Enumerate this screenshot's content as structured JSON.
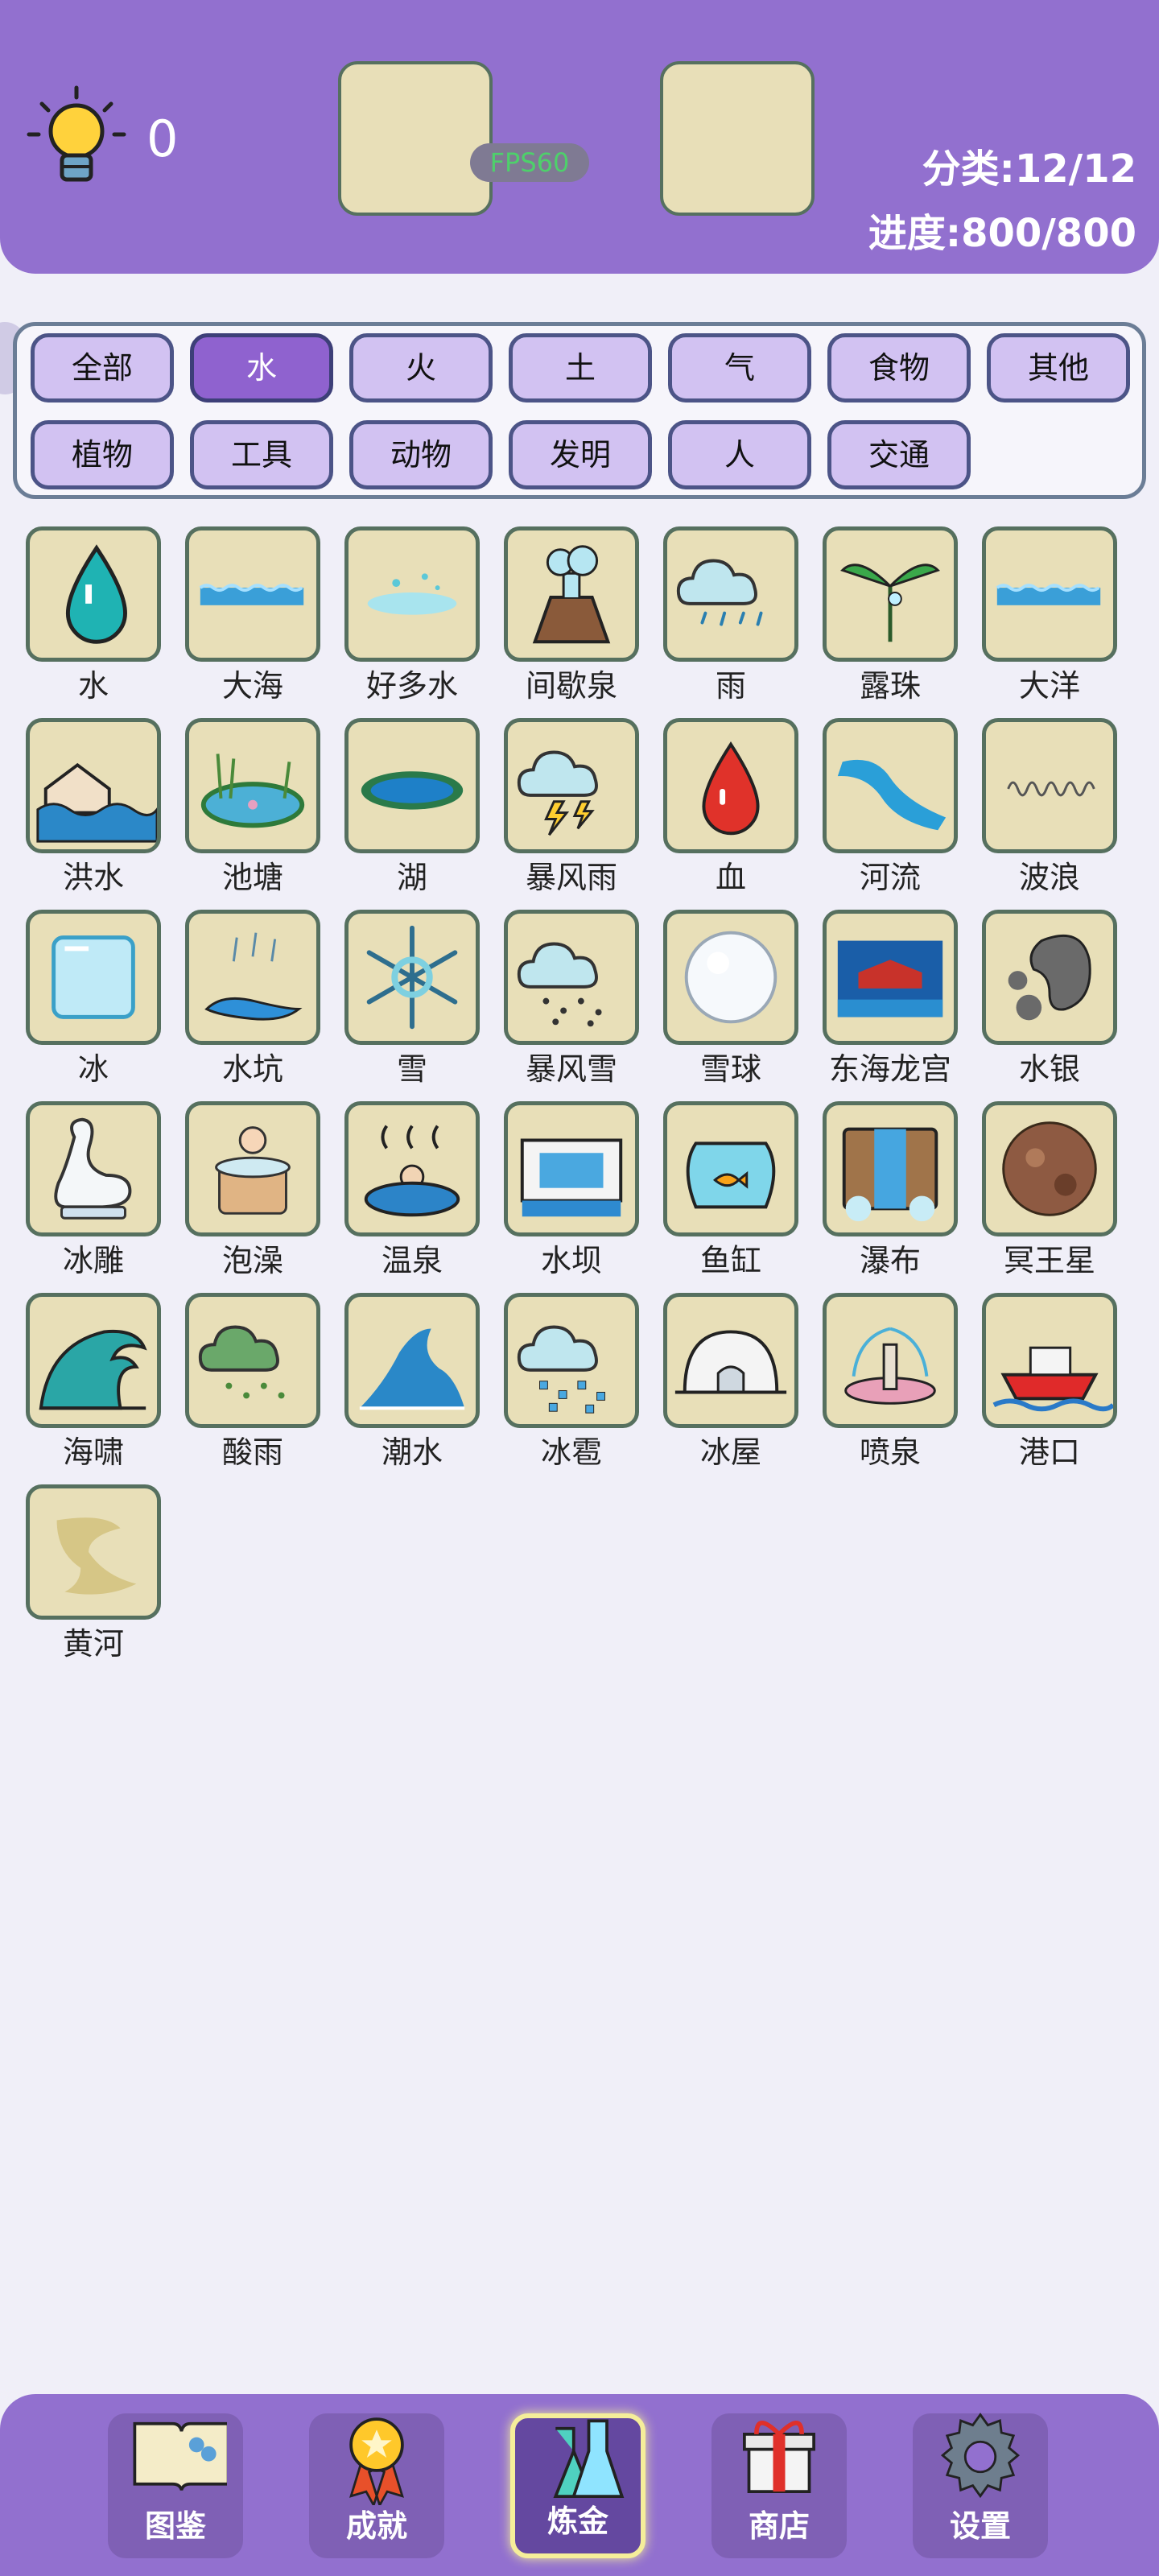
{
  "header": {
    "hint_count": "0",
    "fps": "FPS60",
    "category_stat": "分类:12/12",
    "progress_stat": "进度:800/800"
  },
  "categories": [
    "全部",
    "水",
    "火",
    "土",
    "气",
    "食物",
    "其他",
    "植物",
    "工具",
    "动物",
    "发明",
    "人",
    "交通"
  ],
  "active_category": "水",
  "items": [
    {
      "label": "水",
      "icon": "water-drop-icon"
    },
    {
      "label": "大海",
      "icon": "sea-icon"
    },
    {
      "label": "好多水",
      "icon": "puddle-splash-icon"
    },
    {
      "label": "间歇泉",
      "icon": "geyser-icon"
    },
    {
      "label": "雨",
      "icon": "rain-cloud-icon"
    },
    {
      "label": "露珠",
      "icon": "dew-plant-icon"
    },
    {
      "label": "大洋",
      "icon": "ocean-icon"
    },
    {
      "label": "洪水",
      "icon": "flood-house-icon"
    },
    {
      "label": "池塘",
      "icon": "pond-icon"
    },
    {
      "label": "湖",
      "icon": "lake-icon"
    },
    {
      "label": "暴风雨",
      "icon": "storm-cloud-icon"
    },
    {
      "label": "血",
      "icon": "blood-drop-icon"
    },
    {
      "label": "河流",
      "icon": "river-icon"
    },
    {
      "label": "波浪",
      "icon": "wave-line-icon"
    },
    {
      "label": "冰",
      "icon": "ice-cube-icon"
    },
    {
      "label": "水坑",
      "icon": "puddle-rain-icon"
    },
    {
      "label": "雪",
      "icon": "snowflake-icon"
    },
    {
      "label": "暴风雪",
      "icon": "blizzard-cloud-icon"
    },
    {
      "label": "雪球",
      "icon": "snowball-icon"
    },
    {
      "label": "东海龙宫",
      "icon": "dragon-palace-icon"
    },
    {
      "label": "水银",
      "icon": "mercury-icon"
    },
    {
      "label": "冰雕",
      "icon": "ice-swan-icon"
    },
    {
      "label": "泡澡",
      "icon": "bath-tub-icon"
    },
    {
      "label": "温泉",
      "icon": "hot-spring-icon"
    },
    {
      "label": "水坝",
      "icon": "dam-icon"
    },
    {
      "label": "鱼缸",
      "icon": "fishbowl-icon"
    },
    {
      "label": "瀑布",
      "icon": "waterfall-icon"
    },
    {
      "label": "冥王星",
      "icon": "pluto-icon"
    },
    {
      "label": "海啸",
      "icon": "tsunami-icon"
    },
    {
      "label": "酸雨",
      "icon": "acid-rain-icon"
    },
    {
      "label": "潮水",
      "icon": "tide-icon"
    },
    {
      "label": "冰雹",
      "icon": "hail-icon"
    },
    {
      "label": "冰屋",
      "icon": "igloo-icon"
    },
    {
      "label": "喷泉",
      "icon": "fountain-icon"
    },
    {
      "label": "港口",
      "icon": "harbor-ship-icon"
    },
    {
      "label": "黄河",
      "icon": "yellow-river-icon"
    }
  ],
  "nav": [
    {
      "label": "图鉴",
      "icon": "book-icon"
    },
    {
      "label": "成就",
      "icon": "medal-icon"
    },
    {
      "label": "炼金",
      "icon": "flask-icon"
    },
    {
      "label": "商店",
      "icon": "gift-icon"
    },
    {
      "label": "设置",
      "icon": "gear-icon"
    }
  ],
  "active_nav": "炼金"
}
